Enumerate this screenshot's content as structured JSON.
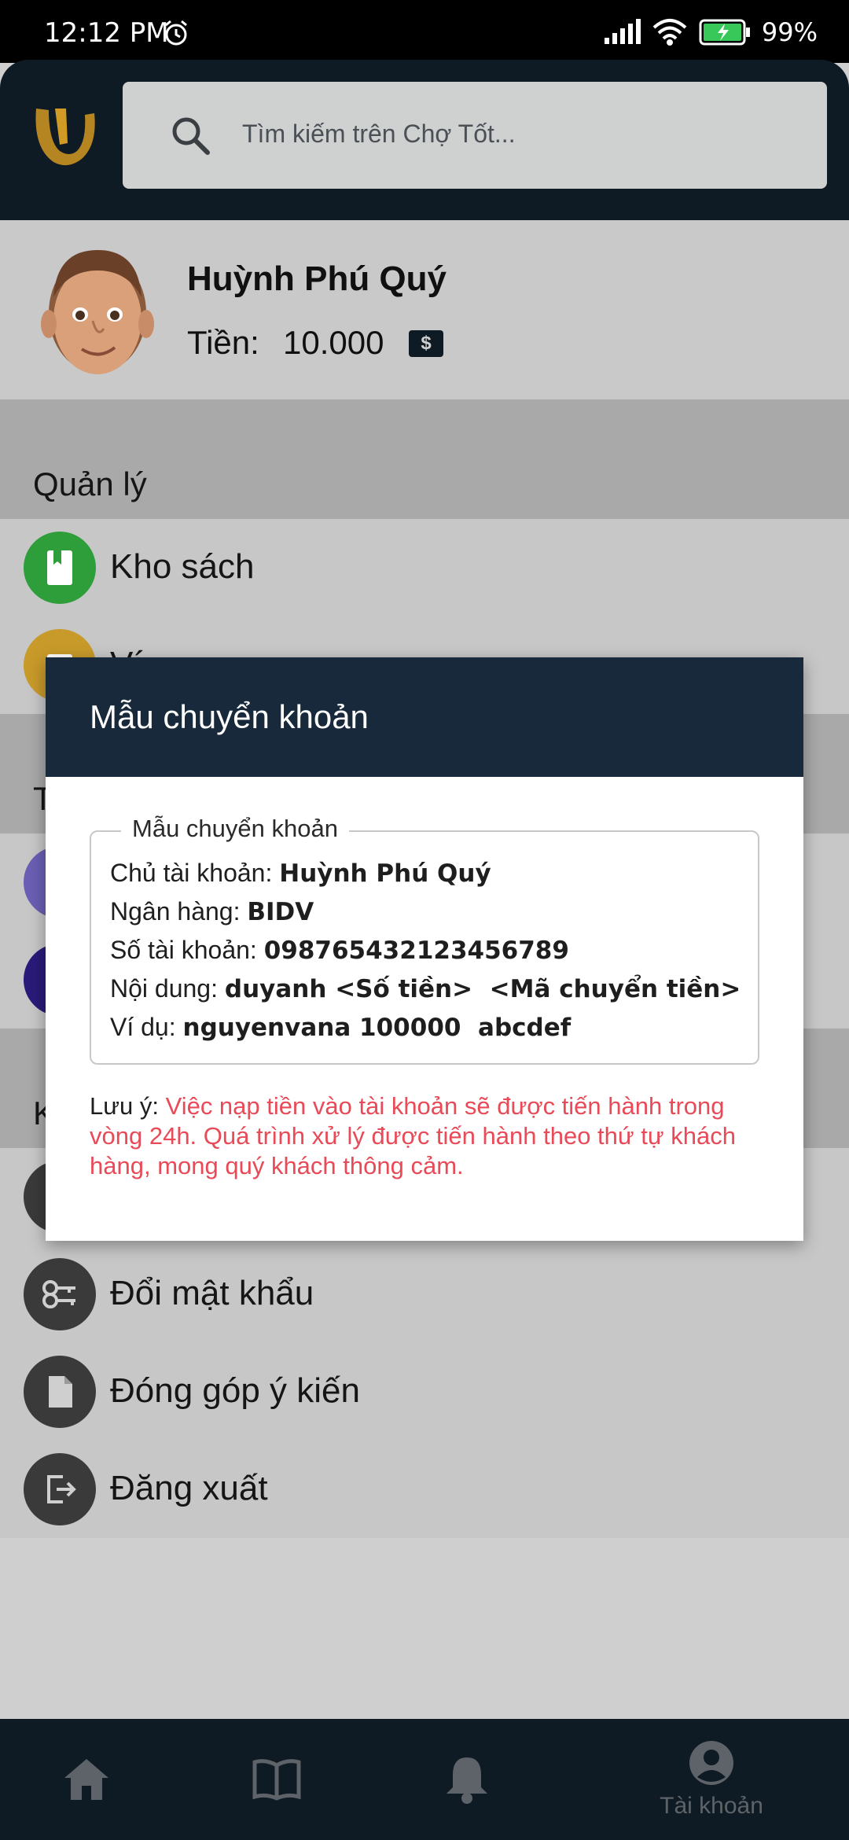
{
  "status_bar": {
    "time": "12:12 PM",
    "battery": "99%"
  },
  "header": {
    "search_placeholder": "Tìm kiếm trên Chợ Tốt..."
  },
  "profile": {
    "name": "Huỳnh Phú Quý",
    "money_label": "Tiền:",
    "money_value": "10.000",
    "money_icon": "$"
  },
  "sections": {
    "manage": {
      "title": "Quản lý",
      "items": [
        {
          "label": "Kho sách",
          "icon": "book-icon",
          "color": "#2e9e3a"
        },
        {
          "label": "Ví",
          "icon": "wallet-icon",
          "color": "#c89a2a"
        }
      ]
    },
    "transactions": {
      "title": "T",
      "items": [
        {
          "label": "",
          "icon": "deposit-icon",
          "color": "#6a5fb4"
        },
        {
          "label": "",
          "icon": "coin-icon",
          "color": "#2a1b7a"
        }
      ]
    },
    "account": {
      "title": "K",
      "items": [
        {
          "label": "",
          "icon": "user-icon",
          "color": "#3a3a3a"
        },
        {
          "label": "Đổi mật khẩu",
          "icon": "key-icon",
          "color": "#3a3a3a"
        },
        {
          "label": "Đóng góp ý kiến",
          "icon": "document-icon",
          "color": "#3a3a3a"
        },
        {
          "label": "Đăng xuất",
          "icon": "logout-icon",
          "color": "#3a3a3a"
        }
      ]
    }
  },
  "dialog": {
    "title": "Mẫu chuyển khoản",
    "legend": "Mẫu chuyển khoản",
    "lines": [
      {
        "label": "Chủ tài khoản: ",
        "value": "Huỳnh Phú Quý"
      },
      {
        "label": "Ngân hàng: ",
        "value": "BIDV"
      },
      {
        "label": "Số tài khoản: ",
        "value": "098765432123456789"
      },
      {
        "label": "Nội dung: ",
        "value": "duyanh <Số tiền>  <Mã chuyển tiền>"
      },
      {
        "label": "Ví dụ: ",
        "value": "nguyenvana 100000  abcdef"
      }
    ],
    "note_label": "Lưu ý: ",
    "note_text": "Việc nạp tiền vào tài khoản sẽ được tiến hành trong vòng 24h. Quá trình xử lý được tiến hành theo thứ tự khách hàng, mong quý khách thông cảm."
  },
  "bottom_nav": {
    "items": [
      {
        "icon": "home-icon",
        "label": ""
      },
      {
        "icon": "book-open-icon",
        "label": ""
      },
      {
        "icon": "bell-icon",
        "label": ""
      },
      {
        "icon": "account-circle-icon",
        "label": "Tài khoản"
      }
    ]
  }
}
